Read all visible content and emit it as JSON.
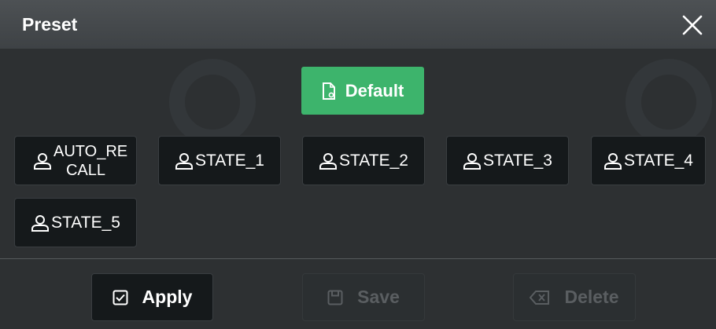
{
  "dialog": {
    "title": "Preset",
    "close_icon": "close-icon"
  },
  "default_button": {
    "label": "Default",
    "icon": "document-reset-icon",
    "color": "#3db46c"
  },
  "states": [
    {
      "label": "AUTO_RECALL",
      "display": "AUTO_RE CALL",
      "icon": "user-icon"
    },
    {
      "label": "STATE_1",
      "icon": "user-icon"
    },
    {
      "label": "STATE_2",
      "icon": "user-icon"
    },
    {
      "label": "STATE_3",
      "icon": "user-icon"
    },
    {
      "label": "STATE_4",
      "icon": "user-icon"
    },
    {
      "label": "STATE_5",
      "icon": "user-icon"
    }
  ],
  "footer": {
    "apply": {
      "label": "Apply",
      "icon": "checkbox-icon",
      "enabled": true
    },
    "save": {
      "label": "Save",
      "icon": "save-icon",
      "enabled": false
    },
    "delete": {
      "label": "Delete",
      "icon": "backspace-icon",
      "enabled": false
    }
  },
  "colors": {
    "background": "#2d3032",
    "title_bar": "#45494c",
    "button": "#15191b",
    "accent_green": "#3db46c"
  }
}
